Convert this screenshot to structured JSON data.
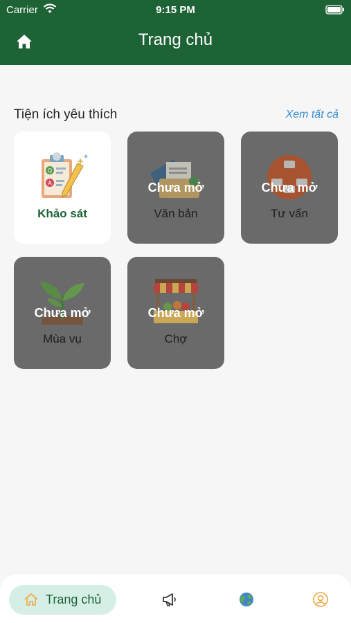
{
  "status_bar": {
    "carrier": "Carrier",
    "time": "9:15 PM"
  },
  "header": {
    "title": "Trang chủ",
    "home_icon": "home-icon"
  },
  "favorites": {
    "title": "Tiện ích yêu thích",
    "see_all": "Xem tất cả",
    "items": [
      {
        "label": "Khảo sát",
        "locked": false,
        "icon": "survey-clipboard-icon"
      },
      {
        "label": "Văn bản",
        "locked": true,
        "lock_text": "Chưa mở",
        "icon": "documents-icon"
      },
      {
        "label": "Tư vấn",
        "locked": true,
        "lock_text": "Chưa mở",
        "icon": "consulting-icon"
      },
      {
        "label": "Mùa vụ",
        "locked": true,
        "lock_text": "Chưa mở",
        "icon": "crop-season-icon"
      },
      {
        "label": "Chợ",
        "locked": true,
        "lock_text": "Chưa mở",
        "icon": "market-stall-icon"
      }
    ]
  },
  "bottom_nav": {
    "active_label": "Trang chủ",
    "tabs": [
      "home-icon",
      "megaphone-icon",
      "globe-icon",
      "profile-icon"
    ]
  },
  "colors": {
    "primary": "#1e6336",
    "link": "#3a8fd3",
    "active_tab_bg": "#d6efe6",
    "locked_tile": "#6a6a6a"
  }
}
